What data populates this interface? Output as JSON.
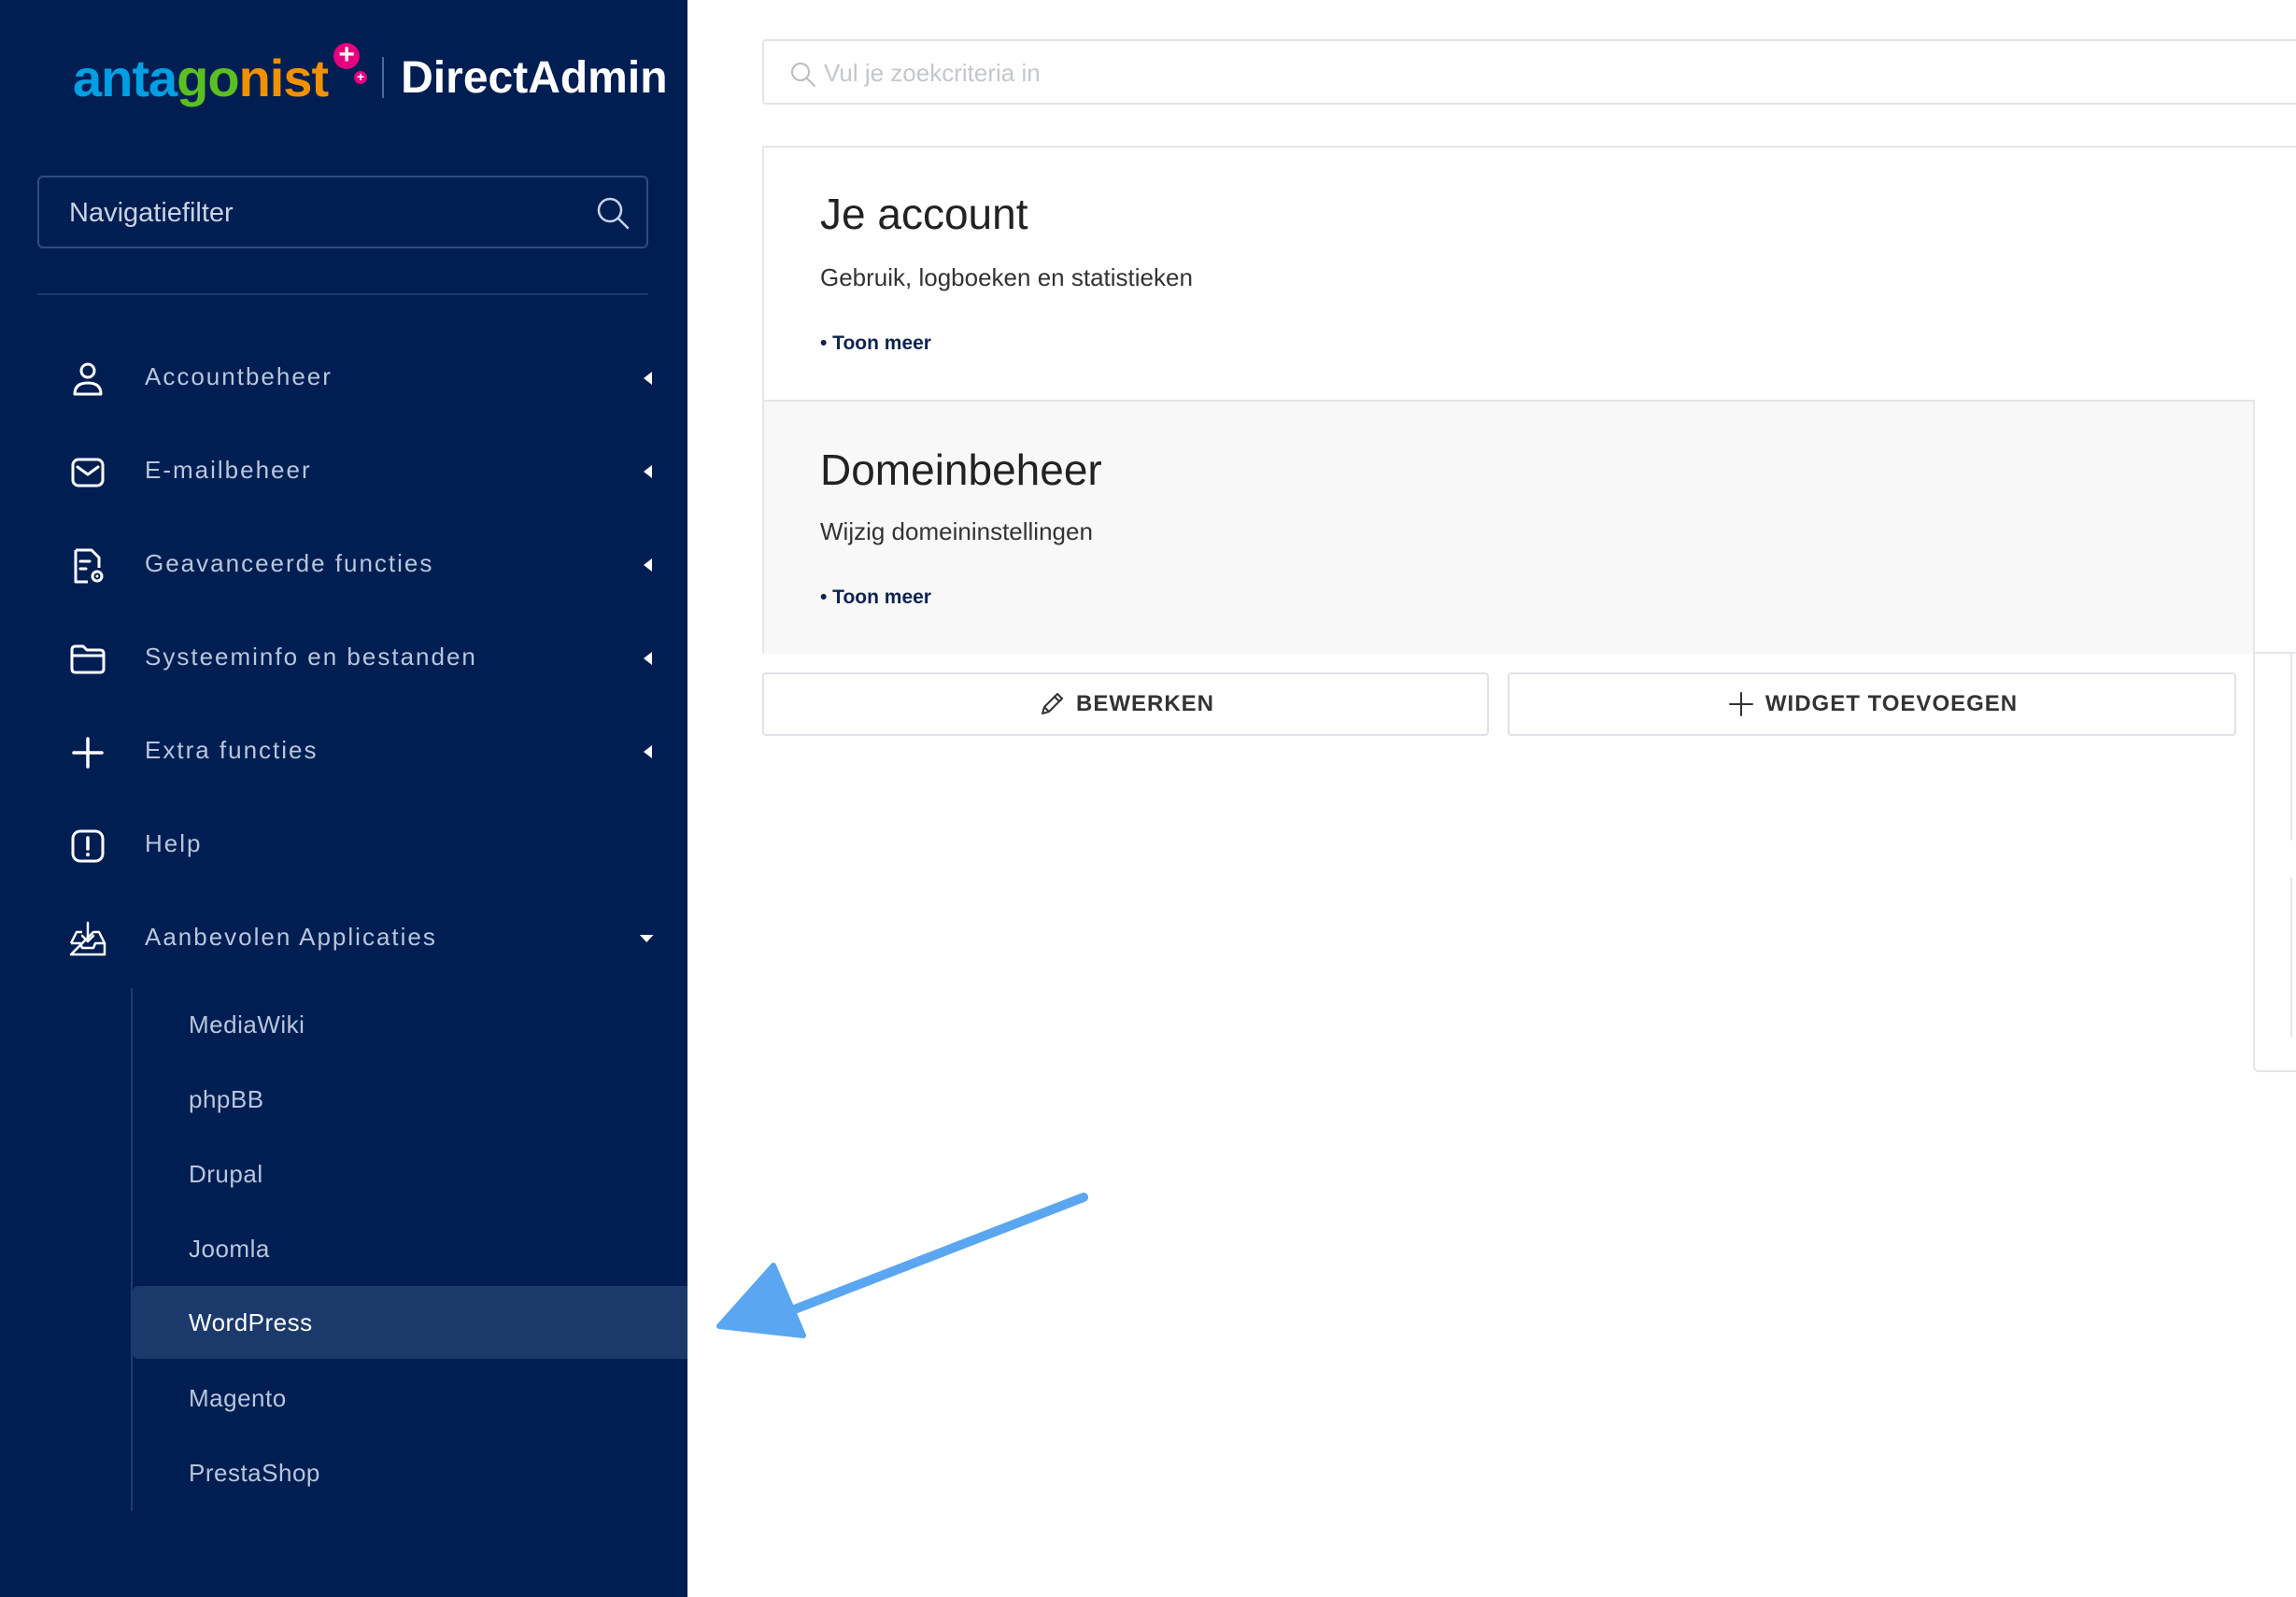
{
  "brand": {
    "logo_left": "antagonist",
    "logo_right": "DirectAdmin",
    "colors": [
      "#009fe3",
      "#5bbf21",
      "#f29100",
      "#e5007e"
    ]
  },
  "sidebar": {
    "filter_placeholder": "Navigatiefilter",
    "items": [
      {
        "label": "Accountbeheer",
        "icon": "user-icon"
      },
      {
        "label": "E-mailbeheer",
        "icon": "mail-icon"
      },
      {
        "label": "Geavanceerde functies",
        "icon": "document-settings-icon"
      },
      {
        "label": "Systeeminfo en bestanden",
        "icon": "folder-icon"
      },
      {
        "label": "Extra functies",
        "icon": "plus-icon"
      },
      {
        "label": "Help",
        "icon": "alert-icon"
      },
      {
        "label": "Aanbevolen Applicaties",
        "icon": "download-tray-icon"
      }
    ],
    "apps": [
      "MediaWiki",
      "phpBB",
      "Drupal",
      "Joomla",
      "WordPress",
      "Magento",
      "PrestaShop"
    ],
    "active_app": "WordPress"
  },
  "main": {
    "search_placeholder": "Vul je zoekcriteria in",
    "cards": [
      {
        "title": "Je account",
        "subtitle": "Gebruik, logboeken en statistieken",
        "link": "• Toon meer"
      },
      {
        "title": "Domeinbeheer",
        "subtitle": "Wijzig domeininstellingen",
        "link": "• Toon meer"
      }
    ],
    "buttons": {
      "edit": "BEWERKEN",
      "add_widget": "WIDGET TOEVOEGEN"
    }
  },
  "annotation": {
    "arrow_color": "#5aa6f0"
  }
}
